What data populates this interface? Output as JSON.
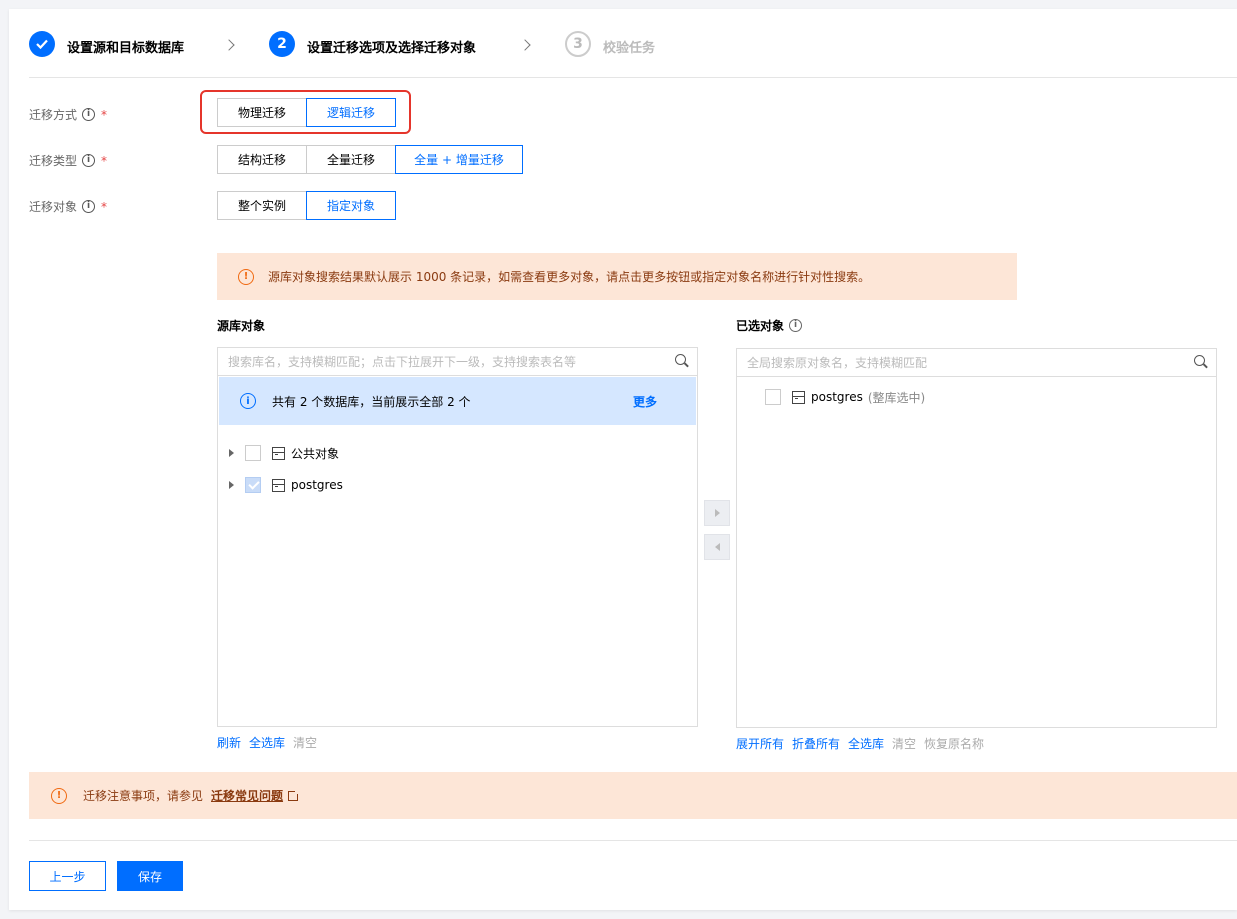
{
  "steps": [
    {
      "number": "✓",
      "label": "设置源和目标数据库",
      "state": "done"
    },
    {
      "number": "2",
      "label": "设置迁移选项及选择迁移对象",
      "state": "active"
    },
    {
      "number": "3",
      "label": "校验任务",
      "state": "todo"
    }
  ],
  "form": {
    "method": {
      "label": "迁移方式",
      "required": "*",
      "options": [
        "物理迁移",
        "逻辑迁移"
      ],
      "selected": "逻辑迁移"
    },
    "type": {
      "label": "迁移类型",
      "required": "*",
      "options": [
        "结构迁移",
        "全量迁移",
        "全量 + 增量迁移"
      ],
      "selected": "全量 + 增量迁移"
    },
    "object": {
      "label": "迁移对象",
      "required": "*",
      "options": [
        "整个实例",
        "指定对象"
      ],
      "selected": "指定对象"
    }
  },
  "notice": "源库对象搜索结果默认展示 1000 条记录，如需查看更多对象，请点击更多按钮或指定对象名称进行针对性搜索。",
  "source_panel": {
    "title": "源库对象",
    "search_placeholder": "搜索库名，支持模糊匹配；点击下拉展开下一级，支持搜索表名等",
    "info_text": "共有 2 个数据库，当前展示全部 2 个",
    "more_label": "更多",
    "items": [
      {
        "label": "公共对象",
        "checked": false
      },
      {
        "label": "postgres",
        "checked": true
      }
    ],
    "actions": [
      {
        "label": "刷新",
        "enabled": true
      },
      {
        "label": "全选库",
        "enabled": true
      },
      {
        "label": "清空",
        "enabled": false
      }
    ]
  },
  "selected_panel": {
    "title": "已选对象",
    "search_placeholder": "全局搜索原对象名，支持模糊匹配",
    "items": [
      {
        "label": "postgres",
        "note": "(整库选中)"
      }
    ],
    "actions": [
      {
        "label": "展开所有",
        "enabled": true
      },
      {
        "label": "折叠所有",
        "enabled": true
      },
      {
        "label": "全选库",
        "enabled": true
      },
      {
        "label": "清空",
        "enabled": false
      },
      {
        "label": "恢复原名称",
        "enabled": false
      }
    ]
  },
  "footer_notice": {
    "text": "迁移注意事项，请参见",
    "link": "迁移常见问题"
  },
  "buttons": {
    "prev": "上一步",
    "save": "保存"
  },
  "colors": {
    "primary": "#006eff",
    "warning_bg": "#fde6d7",
    "warning_icon": "#f06a12",
    "info_bg": "#d5e7ff",
    "highlight": "#e5352b"
  }
}
